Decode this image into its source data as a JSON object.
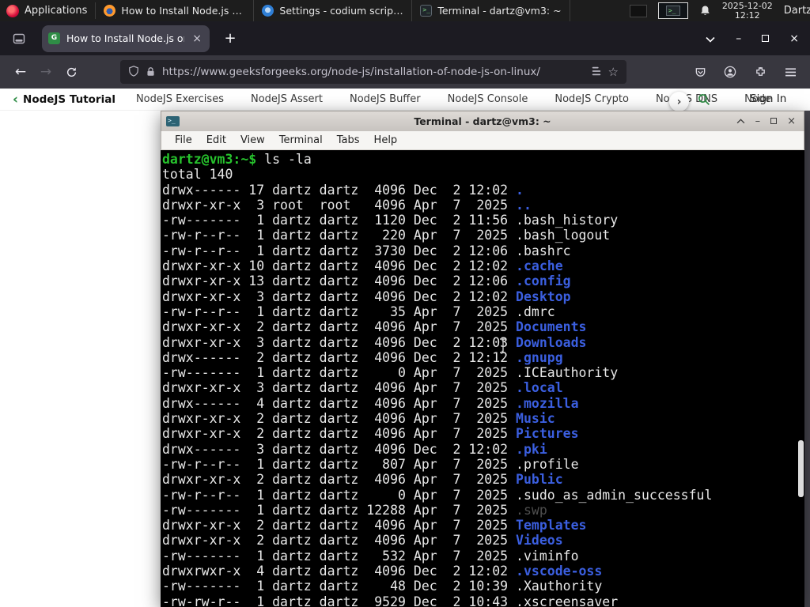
{
  "taskbar": {
    "applications": "Applications",
    "windows": [
      {
        "icon": "firefox",
        "title": "How to Install Node.js o..."
      },
      {
        "icon": "settings",
        "title": "Settings - codium script..."
      },
      {
        "icon": "terminal",
        "title": "Terminal - dartz@vm3: ~"
      }
    ],
    "clock": {
      "date": "2025-12-02",
      "time": "12:12"
    },
    "user": "Dartz"
  },
  "browser": {
    "tab_title": "How to Install Node.js on...",
    "favicon_letter": "G",
    "url": "https://www.geeksforgeeks.org/node-js/installation-of-node-js-on-linux/"
  },
  "site_nav": {
    "primary": "NodeJS Tutorial",
    "items": [
      "NodeJS Exercises",
      "NodeJS Assert",
      "NodeJS Buffer",
      "NodeJS Console",
      "NodeJS Crypto",
      "NodeJS DNS",
      "Node"
    ],
    "more_chevron": "›",
    "back_chevron": "‹",
    "sign_in": "Sign In"
  },
  "terminal": {
    "title": "Terminal - dartz@vm3: ~",
    "menu": [
      "File",
      "Edit",
      "View",
      "Terminal",
      "Tabs",
      "Help"
    ],
    "prompt": "dartz@vm3:~$",
    "command": " ls -la",
    "total": "total 140",
    "listing": [
      {
        "pre": "drwx------ 17 dartz dartz  4096 Dec  2 12:02 ",
        "name": ".",
        "type": "dir"
      },
      {
        "pre": "drwxr-xr-x  3 root  root   4096 Apr  7  2025 ",
        "name": "..",
        "type": "dir"
      },
      {
        "pre": "-rw-------  1 dartz dartz  1120 Dec  2 11:56 ",
        "name": ".bash_history",
        "type": "file"
      },
      {
        "pre": "-rw-r--r--  1 dartz dartz   220 Apr  7  2025 ",
        "name": ".bash_logout",
        "type": "file"
      },
      {
        "pre": "-rw-r--r--  1 dartz dartz  3730 Dec  2 12:06 ",
        "name": ".bashrc",
        "type": "file"
      },
      {
        "pre": "drwxr-xr-x 10 dartz dartz  4096 Dec  2 12:02 ",
        "name": ".cache",
        "type": "dir"
      },
      {
        "pre": "drwxr-xr-x 13 dartz dartz  4096 Dec  2 12:06 ",
        "name": ".config",
        "type": "dir"
      },
      {
        "pre": "drwxr-xr-x  3 dartz dartz  4096 Dec  2 12:02 ",
        "name": "Desktop",
        "type": "dir"
      },
      {
        "pre": "-rw-r--r--  1 dartz dartz    35 Apr  7  2025 ",
        "name": ".dmrc",
        "type": "file"
      },
      {
        "pre": "drwxr-xr-x  2 dartz dartz  4096 Apr  7  2025 ",
        "name": "Documents",
        "type": "dir"
      },
      {
        "pre": "drwxr-xr-x  3 dartz dartz  4096 Dec  2 12:03 ",
        "name": "Downloads",
        "type": "dir"
      },
      {
        "pre": "drwx------  2 dartz dartz  4096 Dec  2 12:12 ",
        "name": ".gnupg",
        "type": "dir"
      },
      {
        "pre": "-rw-------  1 dartz dartz     0 Apr  7  2025 ",
        "name": ".ICEauthority",
        "type": "file"
      },
      {
        "pre": "drwxr-xr-x  3 dartz dartz  4096 Apr  7  2025 ",
        "name": ".local",
        "type": "dir"
      },
      {
        "pre": "drwx------  4 dartz dartz  4096 Apr  7  2025 ",
        "name": ".mozilla",
        "type": "dir"
      },
      {
        "pre": "drwxr-xr-x  2 dartz dartz  4096 Apr  7  2025 ",
        "name": "Music",
        "type": "dir"
      },
      {
        "pre": "drwxr-xr-x  2 dartz dartz  4096 Apr  7  2025 ",
        "name": "Pictures",
        "type": "dir"
      },
      {
        "pre": "drwx------  3 dartz dartz  4096 Dec  2 12:02 ",
        "name": ".pki",
        "type": "dir"
      },
      {
        "pre": "-rw-r--r--  1 dartz dartz   807 Apr  7  2025 ",
        "name": ".profile",
        "type": "file"
      },
      {
        "pre": "drwxr-xr-x  2 dartz dartz  4096 Apr  7  2025 ",
        "name": "Public",
        "type": "dir"
      },
      {
        "pre": "-rw-r--r--  1 dartz dartz     0 Apr  7  2025 ",
        "name": ".sudo_as_admin_successful",
        "type": "file"
      },
      {
        "pre": "-rw-------  1 dartz dartz 12288 Apr  7  2025 ",
        "name": ".swp",
        "type": "dim"
      },
      {
        "pre": "drwxr-xr-x  2 dartz dartz  4096 Apr  7  2025 ",
        "name": "Templates",
        "type": "dir"
      },
      {
        "pre": "drwxr-xr-x  2 dartz dartz  4096 Apr  7  2025 ",
        "name": "Videos",
        "type": "dir"
      },
      {
        "pre": "-rw-------  1 dartz dartz   532 Apr  7  2025 ",
        "name": ".viminfo",
        "type": "file"
      },
      {
        "pre": "drwxrwxr-x  4 dartz dartz  4096 Dec  2 12:02 ",
        "name": ".vscode-oss",
        "type": "dir"
      },
      {
        "pre": "-rw-------  1 dartz dartz    48 Dec  2 10:39 ",
        "name": ".Xauthority",
        "type": "file"
      },
      {
        "pre": "-rw-rw-r--  1 dartz dartz  9529 Dec  2 10:43 ",
        "name": ".xscreensaver",
        "type": "file"
      }
    ]
  },
  "colors": {
    "accent_green": "#2f8d46",
    "terminal_prompt": "#27c32d",
    "terminal_dir_blue": "#3b5fe0",
    "terminal_dim": "#4e4e4e"
  }
}
